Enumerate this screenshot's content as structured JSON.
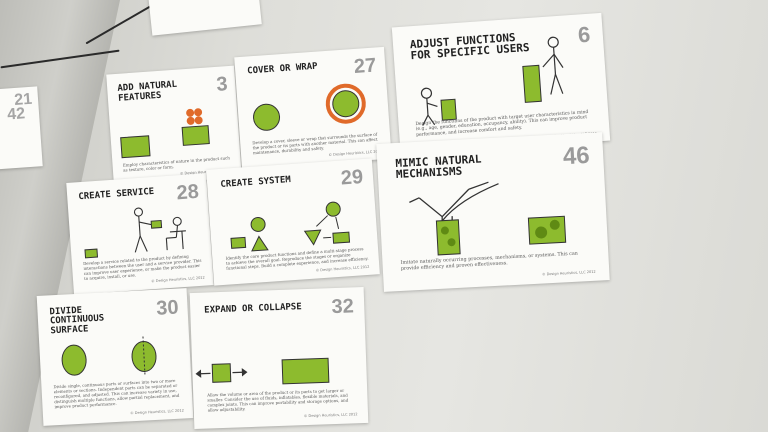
{
  "colors": {
    "accent": "#8dbb2e",
    "accent_dark": "#5f8a14",
    "orange": "#e06a2a",
    "ink": "#333333",
    "number": "#9a9a9a"
  },
  "cards": [
    {
      "id": "card-3",
      "title": "Add natural features",
      "number": "3",
      "desc": "Employ characteristics of nature in the product such as texture, color or form.",
      "copy": "© Design Heuristics, LLC 2012"
    },
    {
      "id": "card-27",
      "title": "Cover or wrap",
      "number": "27",
      "desc": "Develop a cover, sleeve or wrap that surrounds the surface of the product or its parts with another material. This can affect maintenance, durability and safety.",
      "copy": "© Design Heuristics, LLC 2012"
    },
    {
      "id": "card-6",
      "title": "Adjust functions for specific users",
      "number": "6",
      "desc": "Design the functions of the product with target user characteristics in mind (e.g., age, gender, education, occupancy, ability). This can improve product performance, and increase comfort and safety.",
      "copy": "© Design Heuristics, LLC 2012"
    },
    {
      "id": "card-28",
      "title": "Create service",
      "number": "28",
      "desc": "Develop a service related to the product by defining interactions between the user and a service provider. This can improve user experience, or make the product easier to acquire, install, or use.",
      "copy": "© Design Heuristics, LLC 2012"
    },
    {
      "id": "card-29",
      "title": "Create system",
      "number": "29",
      "desc": "Identify the core product functions and define a multi-stage process to achieve the overall goal. Reproduce the stages or organize functional steps. Build a complete experience, and increase efficiency.",
      "copy": "© Design Heuristics, LLC 2012"
    },
    {
      "id": "card-46",
      "title": "Mimic natural mechanisms",
      "number": "46",
      "desc": "Imitate naturally occurring processes, mechanisms, or systems. This can provide efficiency and proven effectiveness.",
      "copy": "© Design Heuristics, LLC 2012"
    },
    {
      "id": "card-30",
      "title": "Divide continuous surface",
      "number": "30",
      "desc": "Divide single, continuous parts or surfaces into two or more elements or sections. Independent parts can be separated or reconfigured, and adjusted. This can increase variety in use, distinguish multiple functions, allow partial replacement, and improve product performance.",
      "copy": "© Design Heuristics, LLC 2012"
    },
    {
      "id": "card-32",
      "title": "Expand or collapse",
      "number": "32",
      "desc": "Allow the volume or area of the product or its parts to get larger or smaller. Consider the use of fluids, inflatables, flexible materials, and complex joints. This can improve portability and storage options, and allow adjustability.",
      "copy": "© Design Heuristics, LLC 2012"
    }
  ],
  "partial_cards": [
    {
      "number": "21"
    },
    {
      "number": "42"
    }
  ]
}
